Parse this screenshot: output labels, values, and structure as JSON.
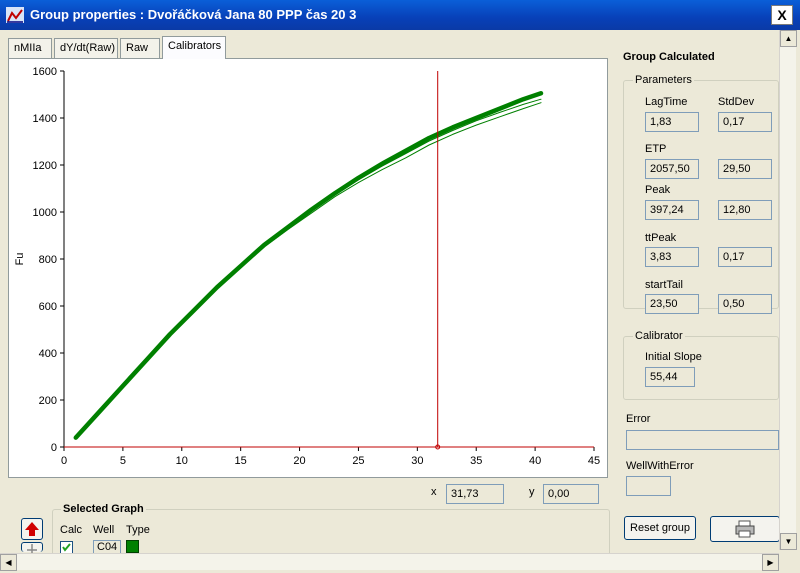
{
  "window": {
    "title": "Group properties : Dvořáčková Jana 80 PPP čas 20 3",
    "close_label": "X"
  },
  "tabs": [
    "nMIIa",
    "dY/dt(Raw)",
    "Raw",
    "Calibrators"
  ],
  "active_tab": "Calibrators",
  "chart": {
    "ylabel": "Fu",
    "y_ticks": [
      "0",
      "200",
      "400",
      "600",
      "800",
      "1000",
      "1200",
      "1400",
      "1600"
    ],
    "x_ticks": [
      "0",
      "5",
      "10",
      "15",
      "20",
      "25",
      "30",
      "35",
      "40",
      "45"
    ],
    "cursor_x_label": "x",
    "cursor_x_value": "31,73",
    "cursor_y_label": "y",
    "cursor_y_value": "0,00",
    "colors": {
      "series": "#008000",
      "cursor": "#c00000"
    }
  },
  "chart_data": {
    "type": "line",
    "title": "",
    "xlabel": "",
    "ylabel": "Fu",
    "xlim": [
      0,
      45
    ],
    "ylim": [
      0,
      1600
    ],
    "grid": false,
    "legend": "none",
    "cursor_x": 31.73,
    "series": [
      {
        "values_x": [
          1,
          3,
          5,
          7,
          9,
          11,
          13,
          15,
          17,
          19,
          21,
          23,
          25,
          27,
          29,
          31,
          33,
          35,
          37,
          39,
          40.5
        ],
        "values_y": [
          40,
          150,
          260,
          370,
          480,
          580,
          680,
          770,
          860,
          935,
          1010,
          1080,
          1145,
          1205,
          1260,
          1315,
          1360,
          1400,
          1440,
          1480,
          1505
        ]
      },
      {
        "values_x": [
          1,
          3,
          5,
          7,
          9,
          11,
          13,
          15,
          17,
          19,
          21,
          23,
          25,
          27,
          29,
          31,
          33,
          35,
          37,
          39,
          40.5
        ],
        "values_y": [
          40,
          148,
          257,
          366,
          475,
          576,
          675,
          765,
          852,
          925,
          995,
          1065,
          1125,
          1180,
          1230,
          1285,
          1330,
          1370,
          1405,
          1440,
          1465
        ]
      },
      {
        "values_x": [
          1,
          3,
          5,
          7,
          9,
          11,
          13,
          15,
          17,
          19,
          21,
          23,
          25,
          27,
          29,
          31,
          33,
          35,
          37,
          39,
          40.5
        ],
        "values_y": [
          40,
          150,
          259,
          369,
          478,
          579,
          679,
          769,
          858,
          932,
          1005,
          1075,
          1137,
          1195,
          1248,
          1302,
          1347,
          1388,
          1424,
          1458,
          1480
        ]
      }
    ]
  },
  "group_calculated": {
    "title": "Group Calculated",
    "parameters_label": "Parameters",
    "lagtime_label": "LagTime",
    "stddev_label": "StdDev",
    "lagtime": "1,83",
    "lagtime_sd": "0,17",
    "etp_label": "ETP",
    "etp": "2057,50",
    "etp_sd": "29,50",
    "peak_label": "Peak",
    "peak": "397,24",
    "peak_sd": "12,80",
    "ttpeak_label": "ttPeak",
    "ttpeak": "3,83",
    "ttpeak_sd": "0,17",
    "starttail_label": "startTail",
    "starttail": "23,50",
    "starttail_sd": "0,50",
    "calibrator_label": "Calibrator",
    "initial_slope_label": "Initial Slope",
    "initial_slope": "55,44",
    "error_label": "Error",
    "error_value": "",
    "wellwitherror_label": "WellWithError",
    "wellwitherror_value": ""
  },
  "selected_graph": {
    "title": "Selected Graph",
    "calc_label": "Calc",
    "well_label": "Well",
    "type_label": "Type",
    "well_value": "C04",
    "calc_checked": true,
    "type_color": "#008000"
  },
  "buttons": {
    "reset_group": "Reset group"
  }
}
